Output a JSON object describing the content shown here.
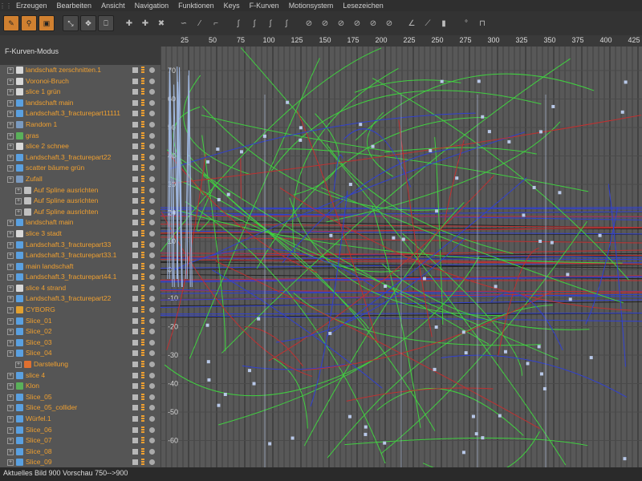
{
  "menu": {
    "items": [
      "Erzeugen",
      "Bearbeiten",
      "Ansicht",
      "Navigation",
      "Funktionen",
      "Keys",
      "F-Kurven",
      "Motionsystem",
      "Lesezeichen"
    ]
  },
  "panel": {
    "mode_label": "F-Kurven-Modus"
  },
  "ruler": {
    "ticks": [
      "25",
      "50",
      "75",
      "100",
      "125",
      "150",
      "175",
      "200",
      "225",
      "250",
      "275",
      "300",
      "325",
      "350",
      "375",
      "400",
      "425"
    ]
  },
  "tree": {
    "items": [
      {
        "label": "landschaft zerschnitten.1",
        "icon": "fracture-icon",
        "color": "#d8d8d8",
        "indent": 0
      },
      {
        "label": "Voronoi-Bruch",
        "icon": "fracture-icon",
        "color": "#d8d8d8",
        "indent": 0
      },
      {
        "label": "slice 1 grün",
        "icon": "fracture-icon",
        "color": "#d8d8d8",
        "indent": 0
      },
      {
        "label": "landschaft main",
        "icon": "polygon-icon",
        "color": "#5aa0e0",
        "indent": 0
      },
      {
        "label": "Landschaft.3_fracturepart11111",
        "icon": "polygon-icon",
        "color": "#5aa0e0",
        "indent": 0
      },
      {
        "label": "Random 1",
        "icon": "effector-icon",
        "color": "#7a9ac0",
        "indent": 0
      },
      {
        "label": "gras",
        "icon": "cloner-icon",
        "color": "#5ab05a",
        "indent": 0
      },
      {
        "label": "slice 2 schnee",
        "icon": "fracture-icon",
        "color": "#d8d8d8",
        "indent": 0
      },
      {
        "label": "Landschaft.3_fracturepart22",
        "icon": "polygon-icon",
        "color": "#5aa0e0",
        "indent": 0
      },
      {
        "label": "scatter bäume grün",
        "icon": "polygon-icon",
        "color": "#5aa0e0",
        "indent": 0
      },
      {
        "label": "Zufall",
        "icon": "effector-icon",
        "color": "#7a9ac0",
        "indent": 0
      },
      {
        "label": "Auf Spline ausrichten",
        "icon": "spline-tag-icon",
        "color": "#c0c0c0",
        "indent": 1
      },
      {
        "label": "Auf Spline ausrichten",
        "icon": "spline-tag-icon",
        "color": "#c0c0c0",
        "indent": 1
      },
      {
        "label": "Auf Spline ausrichten",
        "icon": "spline-tag-icon",
        "color": "#c0c0c0",
        "indent": 1
      },
      {
        "label": "landschaft main",
        "icon": "polygon-icon",
        "color": "#5aa0e0",
        "indent": 0
      },
      {
        "label": "slice 3 stadt",
        "icon": "fracture-icon",
        "color": "#d8d8d8",
        "indent": 0
      },
      {
        "label": "Landschaft.3_fracturepart33",
        "icon": "polygon-icon",
        "color": "#5aa0e0",
        "indent": 0
      },
      {
        "label": "Landschaft.3_fracturepart33.1",
        "icon": "polygon-icon",
        "color": "#5aa0e0",
        "indent": 0
      },
      {
        "label": "main landschaft",
        "icon": "polygon-icon",
        "color": "#5aa0e0",
        "indent": 0
      },
      {
        "label": "Landschaft.3_fracturepart44.1",
        "icon": "polygon-icon",
        "color": "#5aa0e0",
        "indent": 0
      },
      {
        "label": "slice 4 strand",
        "icon": "fracture-icon",
        "color": "#d8d8d8",
        "indent": 0
      },
      {
        "label": "Landschaft.3_fracturepart22",
        "icon": "polygon-icon",
        "color": "#5aa0e0",
        "indent": 0
      },
      {
        "label": "CYBORG",
        "icon": "null-icon",
        "color": "#e0a030",
        "indent": 0
      },
      {
        "label": "Slice_01",
        "icon": "polygon-icon",
        "color": "#5aa0e0",
        "indent": 0
      },
      {
        "label": "Slice_02",
        "icon": "polygon-icon",
        "color": "#5aa0e0",
        "indent": 0
      },
      {
        "label": "Slice_03",
        "icon": "polygon-icon",
        "color": "#5aa0e0",
        "indent": 0
      },
      {
        "label": "Slice_04",
        "icon": "polygon-icon",
        "color": "#5aa0e0",
        "indent": 0
      },
      {
        "label": "Darstellung",
        "icon": "display-tag-icon",
        "color": "#e07030",
        "indent": 1
      },
      {
        "label": "slice 4",
        "icon": "polygon-icon",
        "color": "#5aa0e0",
        "indent": 0
      },
      {
        "label": "Klon",
        "icon": "cloner-icon",
        "color": "#5ab05a",
        "indent": 0
      },
      {
        "label": "Slice_05",
        "icon": "polygon-icon",
        "color": "#5aa0e0",
        "indent": 0
      },
      {
        "label": "Slice_05_collider",
        "icon": "polygon-icon",
        "color": "#5aa0e0",
        "indent": 0
      },
      {
        "label": "Würfel.1",
        "icon": "cube-icon",
        "color": "#5aa0e0",
        "indent": 0
      },
      {
        "label": "Slice_06",
        "icon": "polygon-icon",
        "color": "#5aa0e0",
        "indent": 0
      },
      {
        "label": "Slice_07",
        "icon": "polygon-icon",
        "color": "#5aa0e0",
        "indent": 0
      },
      {
        "label": "Slice_08",
        "icon": "polygon-icon",
        "color": "#5aa0e0",
        "indent": 0
      },
      {
        "label": "Slice_09",
        "icon": "polygon-icon",
        "color": "#5aa0e0",
        "indent": 0
      }
    ]
  },
  "graph": {
    "y_labels": [
      "70",
      "60",
      "50",
      "40",
      "30",
      "20",
      "10",
      "0",
      "-10",
      "-20",
      "-30",
      "-40",
      "-50",
      "-60"
    ],
    "colors": {
      "red": "#c03030",
      "green": "#40d040",
      "blue": "#3040d0",
      "lightblue": "#a0b8e0"
    }
  },
  "status": {
    "text": "Aktuelles Bild  900  Vorschau  750-->900"
  }
}
